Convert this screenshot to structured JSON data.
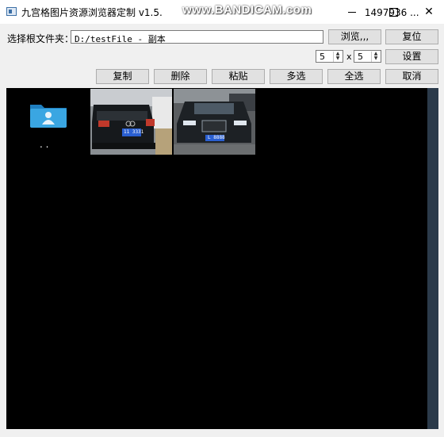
{
  "window": {
    "title": "九宫格图片资源浏览器定制 v1.5.",
    "title_tail": "1497936 ...",
    "watermark": "www.BANDICAM.com"
  },
  "path_row": {
    "label": "选择根文件夹：",
    "value": "D:/testFile - 副本",
    "browse_label": "浏览,,,",
    "reset_label": "复位"
  },
  "grid_row": {
    "rows": "5",
    "separator": "x",
    "cols": "5",
    "set_label": "设置"
  },
  "toolbar": {
    "copy": "复制",
    "delete": "删除",
    "paste": "粘贴",
    "multi_select": "多选",
    "select_all": "全选",
    "cancel": "取消"
  },
  "viewer": {
    "items": [
      {
        "type": "folder",
        "label": ". ."
      },
      {
        "type": "image",
        "plate": "11 3331",
        "plate_color": "#2a5fd1"
      },
      {
        "type": "image",
        "plate": "L 8888",
        "plate_color": "#2a5fd1"
      }
    ]
  },
  "colors": {
    "viewer_bg": "#000000",
    "folder_blue": "#2f9ad8",
    "scrollbar": "#2b3a4a"
  }
}
